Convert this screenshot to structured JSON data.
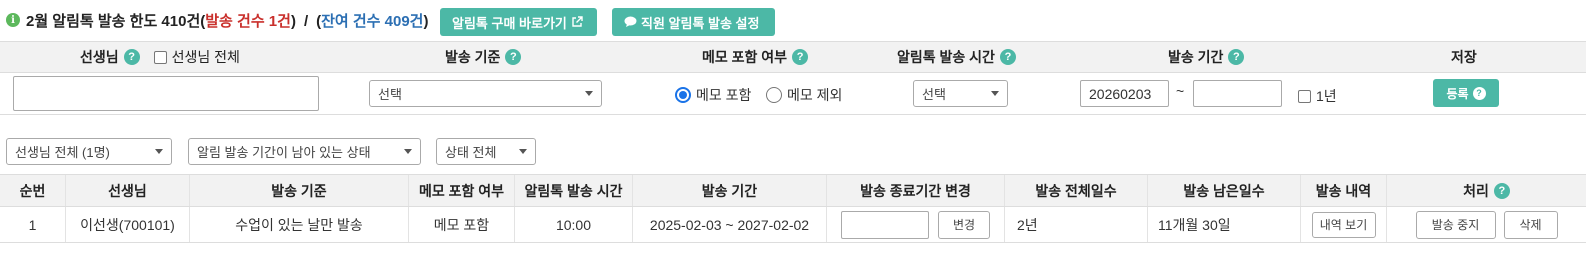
{
  "quota": {
    "prefix": "2월 알림톡 발송 한도 410건(",
    "sent": "발송 건수 1건",
    "slash": "/",
    "remain": "잔여 건수 409건",
    "suffix": ")"
  },
  "buttons": {
    "buy": "알림톡 구매 바로가기",
    "staff": "직원 알림톡 발송 설정"
  },
  "filter_headers": {
    "teacher": "선생님",
    "teacher_all": "선생님 전체",
    "criteria": "발송 기준",
    "memo": "메모 포함 여부",
    "time": "알림톡 발송 시간",
    "period": "발송 기간",
    "save": "저장"
  },
  "filter_values": {
    "teacher_input": "",
    "criteria_select": "선택",
    "memo_include": "메모 포함",
    "memo_exclude": "메모 제외",
    "memo_selected": "include",
    "time_select": "선택",
    "period_start": "20260203",
    "period_tilde": "~",
    "period_end": "",
    "one_year": "1년",
    "register": "등록"
  },
  "list_filters": {
    "teacher": "선생님 전체 (1명)",
    "period_state": "알림 발송 기간이 남아 있는 상태",
    "status": "상태 전체"
  },
  "table": {
    "headers": [
      "순번",
      "선생님",
      "발송 기준",
      "메모 포함 여부",
      "알림톡 발송 시간",
      "발송 기간",
      "발송 종료기간 변경",
      "발송 전체일수",
      "발송 남은일수",
      "발송 내역",
      "처리"
    ],
    "rows": [
      {
        "no": "1",
        "teacher": "이선생(700101)",
        "criteria": "수업이 있는 날만 발송",
        "memo": "메모 포함",
        "time": "10:00",
        "period": "2025-02-03 ~ 2027-02-02",
        "end_change_value": "",
        "change_btn": "변경",
        "total_days": "2년",
        "remain_days": "11개월 30일",
        "history_btn": "내역 보기",
        "stop_btn": "발송 중지",
        "delete_btn": "삭제"
      }
    ]
  },
  "icons": {
    "info": "info-icon",
    "help": "question-icon",
    "external": "external-link-icon",
    "chat": "chat-bubble-icon"
  },
  "colors": {
    "accent": "#4cb8a6",
    "sent_red": "#c9302c",
    "remain_blue": "#2c6fb3"
  }
}
